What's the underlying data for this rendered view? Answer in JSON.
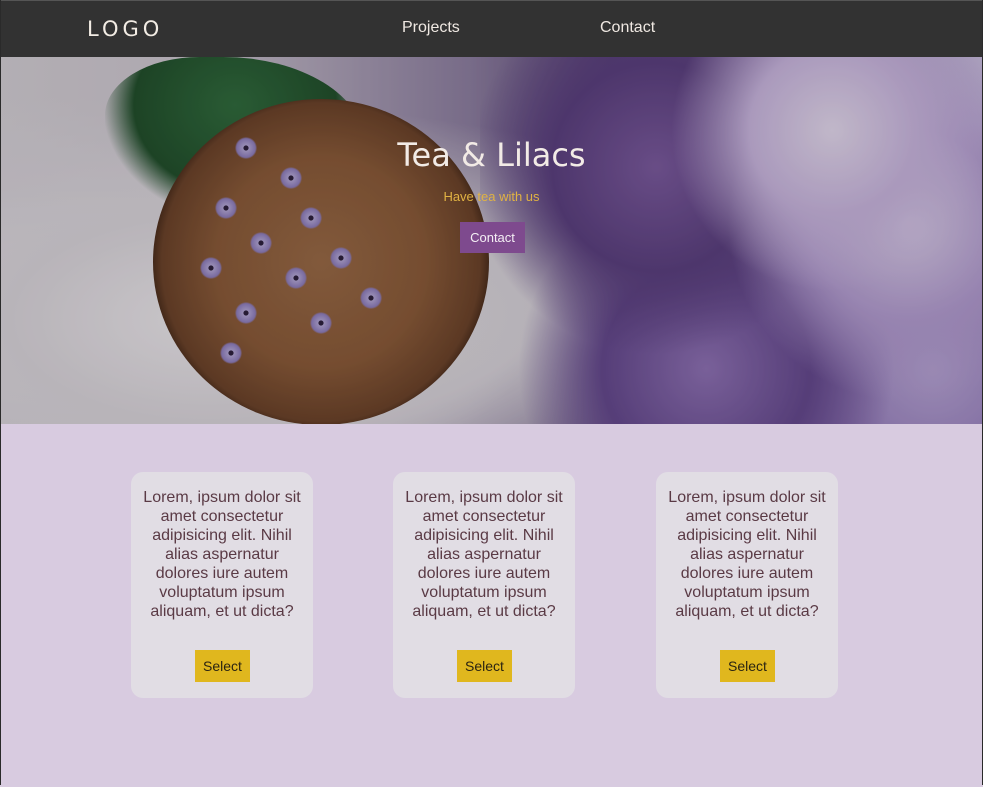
{
  "nav": {
    "logo": "LOGO",
    "links": [
      "Projects",
      "Contact"
    ]
  },
  "hero": {
    "title": "Tea & Lilacs",
    "subtitle": "Have tea with us",
    "button": "Contact"
  },
  "cards": [
    {
      "text": "Lorem, ipsum dolor sit amet consectetur adipisicing elit. Nihil alias aspernatur dolores iure autem voluptatum ipsum aliquam, et ut dicta?",
      "button": "Select"
    },
    {
      "text": "Lorem, ipsum dolor sit amet consectetur adipisicing elit. Nihil alias aspernatur dolores iure autem voluptatum ipsum aliquam, et ut dicta?",
      "button": "Select"
    },
    {
      "text": "Lorem, ipsum dolor sit amet consectetur adipisicing elit. Nihil alias aspernatur dolores iure autem voluptatum ipsum aliquam, et ut dicta?",
      "button": "Select"
    }
  ],
  "colors": {
    "nav_bg": "#323232",
    "page_bg": "#d8cbe0",
    "card_bg": "#e1dde4",
    "hero_button": "#7e4a8e",
    "select_button": "#e0b71e",
    "subtitle": "#e0b243"
  }
}
